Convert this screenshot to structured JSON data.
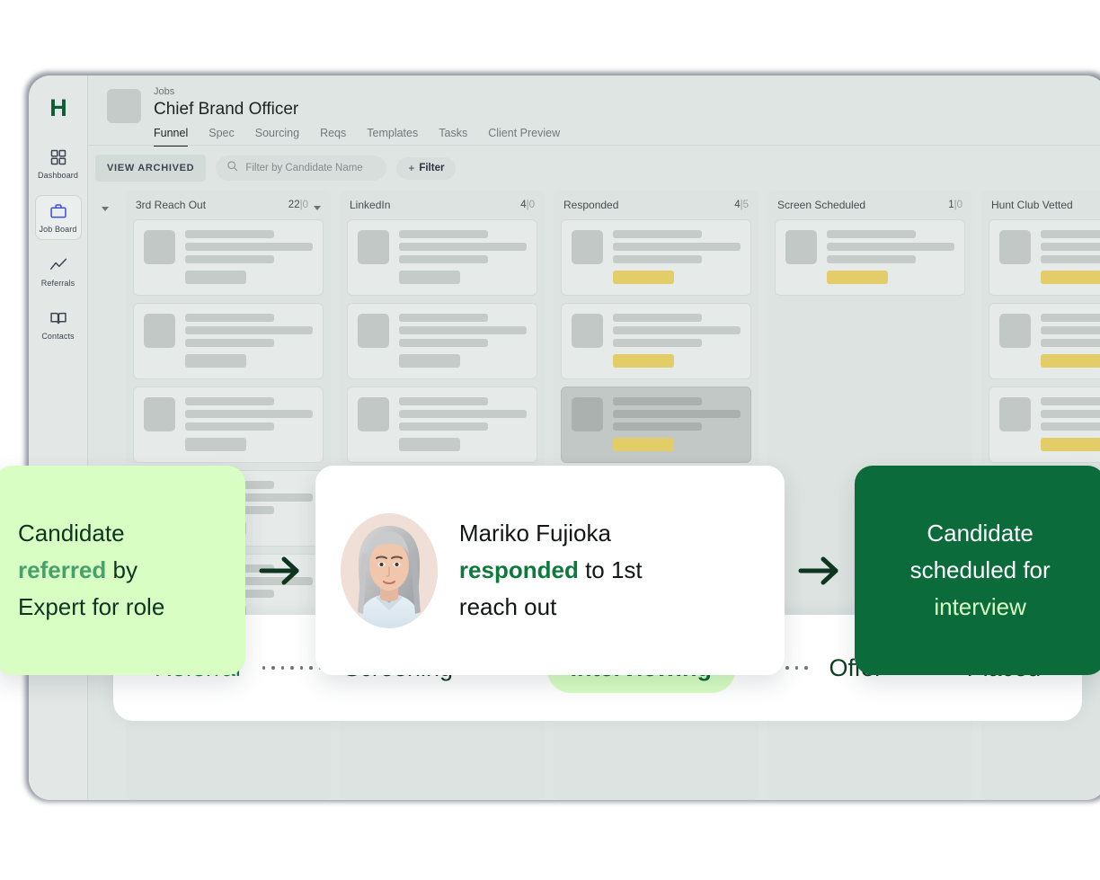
{
  "app": {
    "logo_text": "H"
  },
  "sidebar": {
    "items": [
      {
        "label": "Dashboard",
        "icon": "grid-icon"
      },
      {
        "label": "Job Board",
        "icon": "briefcase-icon"
      },
      {
        "label": "Referrals",
        "icon": "trending-up-icon"
      },
      {
        "label": "Contacts",
        "icon": "book-open-icon"
      }
    ]
  },
  "header": {
    "breadcrumb": "Jobs",
    "title": "Chief Brand Officer",
    "tabs": [
      {
        "label": "Funnel"
      },
      {
        "label": "Spec"
      },
      {
        "label": "Sourcing"
      },
      {
        "label": "Reqs"
      },
      {
        "label": "Templates"
      },
      {
        "label": "Tasks"
      },
      {
        "label": "Client Preview"
      }
    ]
  },
  "toolbar": {
    "view_archived_label": "VIEW ARCHIVED",
    "search_placeholder": "Filter by Candidate Name",
    "filter_plus": "+",
    "filter_label": "Filter"
  },
  "board": {
    "columns": [
      {
        "title": "3rd Reach Out",
        "count": "22",
        "secondary": "0",
        "has_caret": true
      },
      {
        "title": "LinkedIn",
        "count": "4",
        "secondary": "0",
        "has_caret": false
      },
      {
        "title": "Responded",
        "count": "4",
        "secondary": "5",
        "has_caret": false
      },
      {
        "title": "Screen Scheduled",
        "count": "1",
        "secondary": "0",
        "has_caret": false
      },
      {
        "title": "Hunt Club Vetted",
        "count": "",
        "secondary": "",
        "has_caret": false
      }
    ]
  },
  "story": {
    "referral": {
      "line1": "Candidate",
      "highlight": "referred",
      "line2_rest": " by",
      "line3": "Expert for role"
    },
    "responded": {
      "name": "Mariko Fujioka",
      "highlight": "responded",
      "rest": " to 1st",
      "line3": "reach out"
    },
    "scheduled": {
      "line1": "Candidate",
      "line2": "scheduled for",
      "highlight": "interview"
    }
  },
  "stages": {
    "items": [
      {
        "label": "Referral",
        "state": "first"
      },
      {
        "label": "Screening",
        "state": "normal"
      },
      {
        "label": "Interviewing",
        "state": "current"
      },
      {
        "label": "Offer",
        "state": "normal"
      },
      {
        "label": "Placed",
        "state": "normal"
      }
    ]
  },
  "colors": {
    "brand_dark_green": "#0b6b3a",
    "light_green": "#d8fec4",
    "accent_green": "#48a06a",
    "tag_yellow": "#e3cd68",
    "app_bg": "#dfe5e3"
  }
}
